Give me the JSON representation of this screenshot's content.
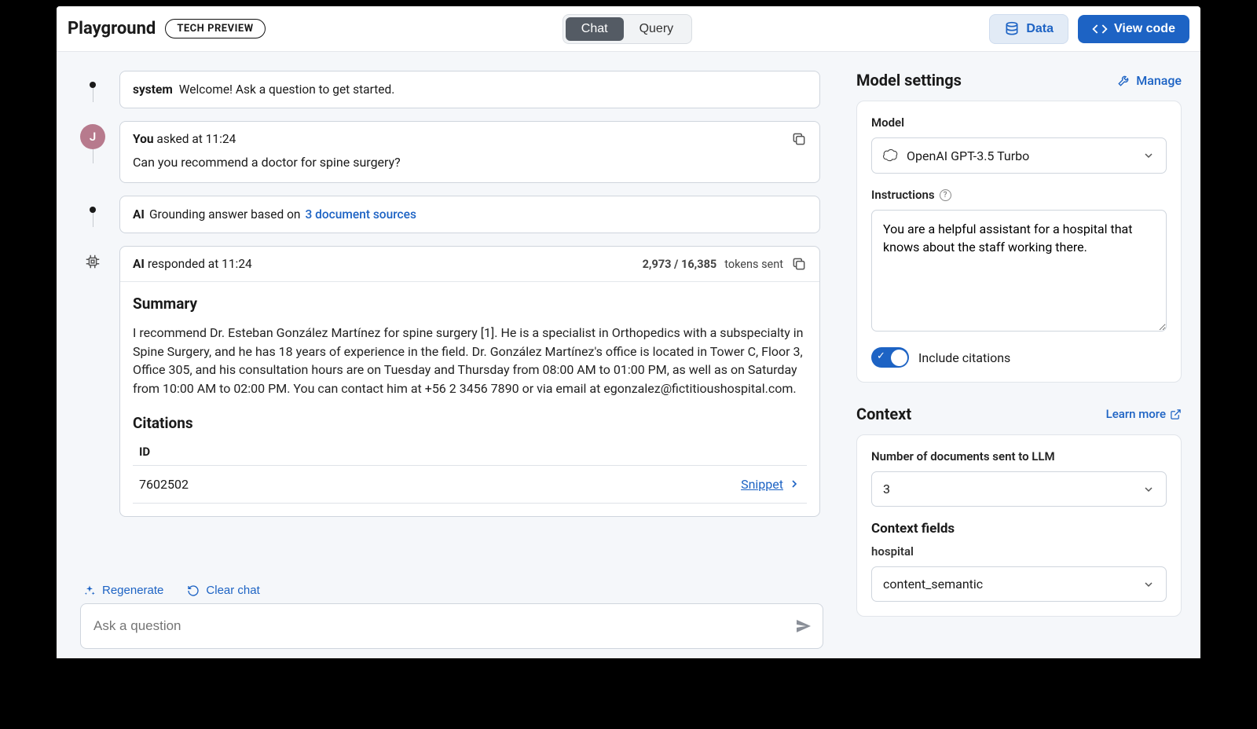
{
  "header": {
    "title": "Playground",
    "badge": "TECH PREVIEW",
    "tabs": {
      "chat": "Chat",
      "query": "Query"
    },
    "data_btn": "Data",
    "view_code_btn": "View code"
  },
  "chat": {
    "system": {
      "who": "system",
      "text": "Welcome! Ask a question to get started."
    },
    "user": {
      "avatar_initial": "J",
      "who": "You",
      "meta": "asked at 11:24",
      "question": "Can you recommend a doctor for spine surgery?"
    },
    "grounding": {
      "who": "AI",
      "text": "Grounding answer based on ",
      "link": "3 document sources"
    },
    "response": {
      "who": "AI",
      "meta": "responded at 11:24",
      "tokens_bold": "2,973 / 16,385",
      "tokens_suffix": " tokens sent",
      "summary_h": "Summary",
      "summary_body": "I recommend Dr. Esteban González Martínez for spine surgery [1]. He is a specialist in Orthopedics with a subspecialty in Spine Surgery, and he has 18 years of experience in the field. Dr. González Martínez's office is located in Tower C, Floor 3, Office 305, and his consultation hours are on Tuesday and Thursday from 08:00 AM to 01:00 PM, as well as on Saturday from 10:00 AM to 02:00 PM. You can contact him at +56 2 3456 7890 or via email at egonzalez@fictitioushospital.com.",
      "citations_h": "Citations",
      "citations_col": "ID",
      "citations": [
        {
          "id": "7602502",
          "snippet_label": "Snippet"
        }
      ]
    },
    "actions": {
      "regenerate": "Regenerate",
      "clear": "Clear chat"
    },
    "input_placeholder": "Ask a question"
  },
  "settings": {
    "title": "Model settings",
    "manage": "Manage",
    "model_label": "Model",
    "model_value": "OpenAI GPT-3.5 Turbo",
    "instructions_label": "Instructions",
    "instructions_value": "You are a helpful assistant for a hospital that knows about the staff working there.",
    "citations_toggle": "Include citations"
  },
  "context": {
    "title": "Context",
    "learn": "Learn more",
    "num_docs_label": "Number of documents sent to LLM",
    "num_docs_value": "3",
    "fields_h": "Context fields",
    "hospital_label": "hospital",
    "hospital_value": "content_semantic"
  }
}
